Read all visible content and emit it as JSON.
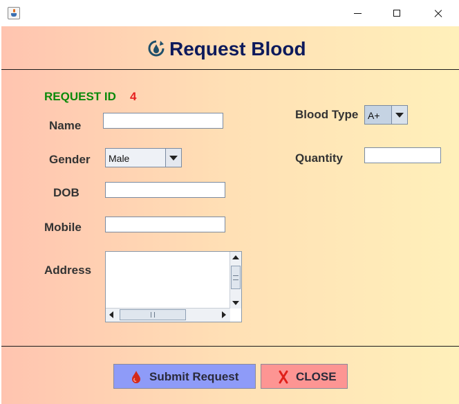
{
  "window": {
    "title": ""
  },
  "header": {
    "title": "Request Blood",
    "icon": "blood-drop-refresh-icon"
  },
  "form": {
    "request_id_label": "REQUEST ID",
    "request_id_value": "4",
    "name_label": "Name",
    "name_value": "",
    "gender_label": "Gender",
    "gender_value": "Male",
    "dob_label": "DOB",
    "dob_value": "",
    "mobile_label": "Mobile",
    "mobile_value": "",
    "address_label": "Address",
    "address_value": "",
    "blood_type_label": "Blood Type",
    "blood_type_value": "A+",
    "quantity_label": "Quantity",
    "quantity_value": ""
  },
  "buttons": {
    "submit_label": "Submit Request",
    "submit_icon": "blood-drop-icon",
    "close_label": "CLOSE",
    "close_icon": "red-x-icon"
  },
  "colors": {
    "title": "#0d1a5c",
    "request_id_label": "#0a8a0a",
    "request_id_value": "#e62020",
    "submit_button": "#8e9bf8",
    "close_button": "#fd9593",
    "background_left": "#ffc4b0",
    "background_right": "#fff0ba"
  }
}
